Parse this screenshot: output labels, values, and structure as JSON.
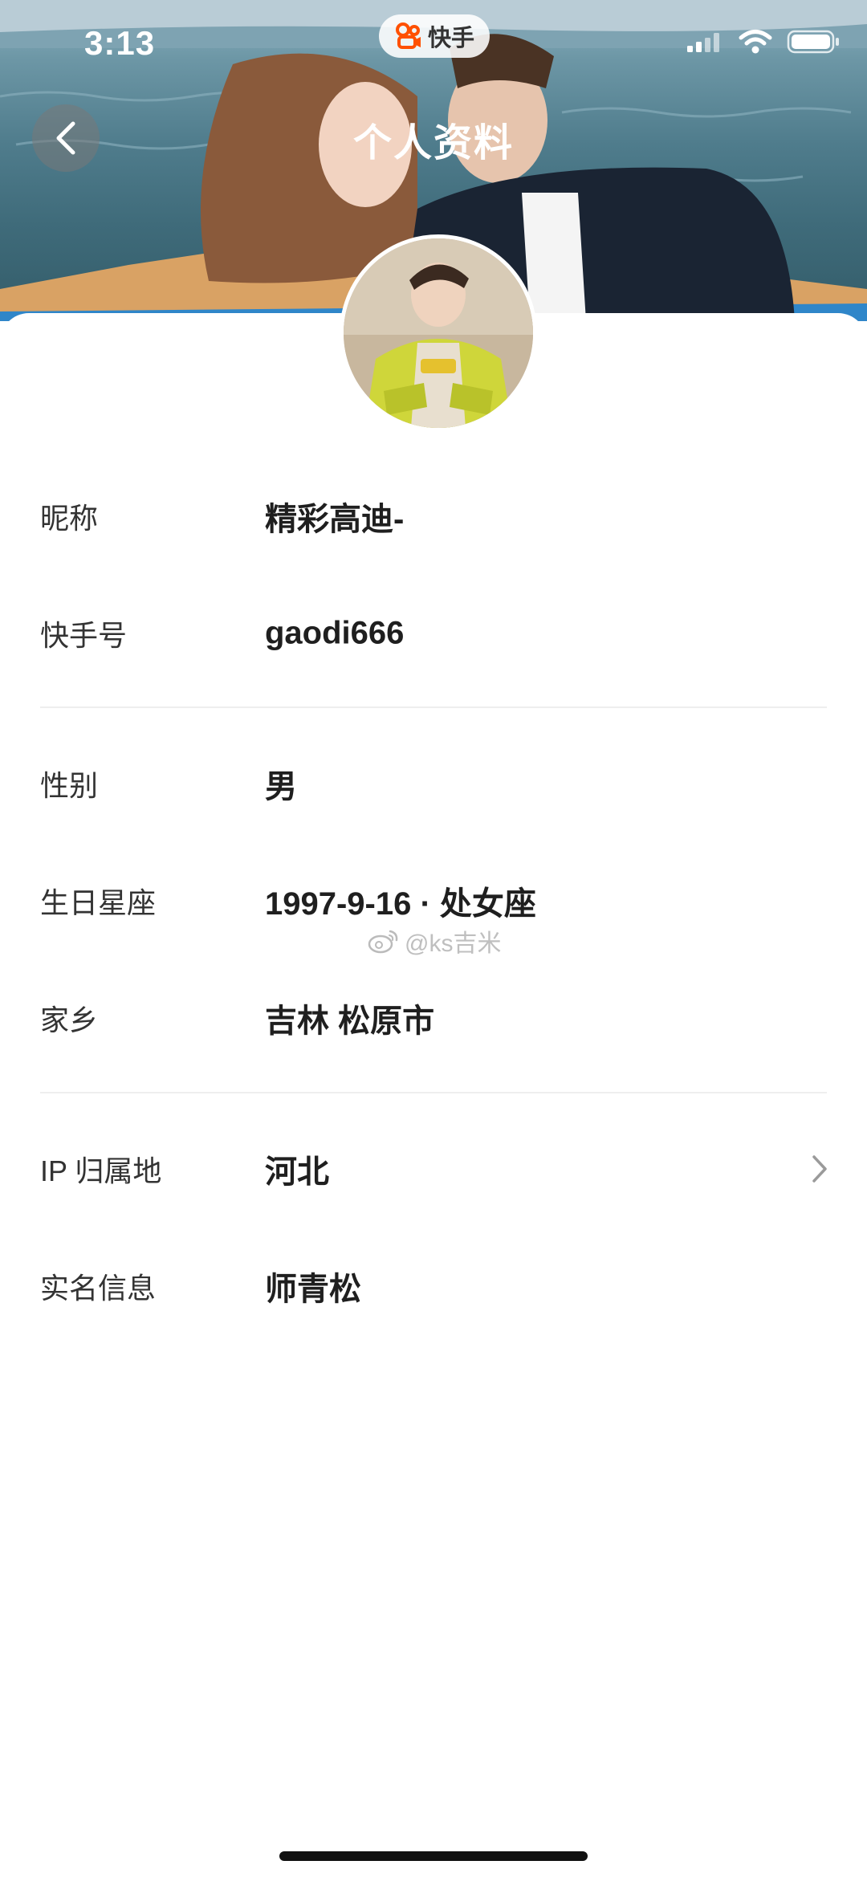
{
  "status_bar": {
    "time": "3:13",
    "app_name": "快手"
  },
  "nav": {
    "title": "个人资料"
  },
  "profile": {
    "rows": [
      {
        "label": "昵称",
        "value": "精彩高迪-"
      },
      {
        "label": "快手号",
        "value": "gaodi666"
      },
      {
        "label": "性别",
        "value": "男"
      },
      {
        "label": "生日星座",
        "value": "1997-9-16 · 处女座"
      },
      {
        "label": "家乡",
        "value": "吉林 松原市"
      },
      {
        "label": "IP 归属地",
        "value": "河北"
      },
      {
        "label": "实名信息",
        "value": "师青松"
      }
    ]
  },
  "watermark": "@ks吉米",
  "icons": [
    "kuaishou-logo-icon",
    "signal-icon",
    "wifi-icon",
    "battery-icon",
    "back-arrow-icon",
    "chevron-right-icon",
    "weibo-icon"
  ],
  "colors": {
    "accent": "#ff5000",
    "value_text": "#1f1f1f",
    "label_text": "#333333",
    "divider": "#eeeeee"
  }
}
